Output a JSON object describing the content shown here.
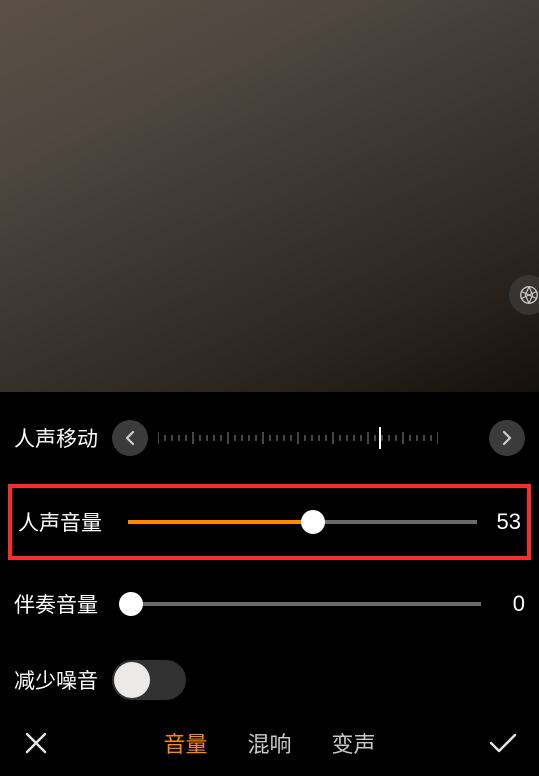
{
  "labels": {
    "voice_shift": "人声移动",
    "voice_volume": "人声音量",
    "accompaniment_volume": "伴奏音量",
    "reduce_noise": "减少噪音"
  },
  "sliders": {
    "voice_shift_indicator_pct": 69,
    "voice_volume_value": 53,
    "voice_volume_pct": 53,
    "accompaniment_value": 0,
    "accompaniment_pct": 0
  },
  "toggles": {
    "reduce_noise_on": false
  },
  "tabs": {
    "volume": "音量",
    "reverb": "混响",
    "voice_change": "变声",
    "active": "volume"
  },
  "colors": {
    "accent": "#ff8a00",
    "highlight": "#ff2b2b"
  }
}
